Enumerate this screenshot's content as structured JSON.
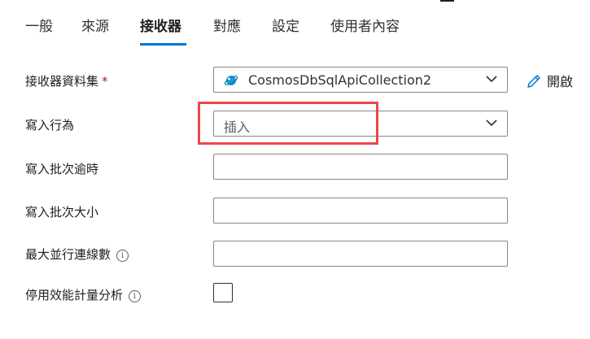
{
  "tabs": [
    {
      "label": "一般",
      "active": false
    },
    {
      "label": "來源",
      "active": false
    },
    {
      "label": "接收器",
      "active": true
    },
    {
      "label": "對應",
      "active": false
    },
    {
      "label": "設定",
      "active": false
    },
    {
      "label": "使用者內容",
      "active": false
    }
  ],
  "form": {
    "dataset": {
      "label": "接收器資料集",
      "required_mark": "*",
      "value": "CosmosDbSqlApiCollection2",
      "icon": "cosmos-db-icon"
    },
    "open_label": "開啟",
    "write_behavior": {
      "label": "寫入行為",
      "placeholder": "插入"
    },
    "batch_timeout": {
      "label": "寫入批次逾時",
      "value": ""
    },
    "batch_size": {
      "label": "寫入批次大小",
      "value": ""
    },
    "max_connections": {
      "label": "最大並行連線數",
      "info": "i",
      "value": ""
    },
    "perf_analytics": {
      "label": "停用效能計量分析",
      "info": "i",
      "checked": false
    }
  },
  "colors": {
    "accent": "#0078d4",
    "highlight": "#e8484c",
    "required": "#a4262c"
  }
}
